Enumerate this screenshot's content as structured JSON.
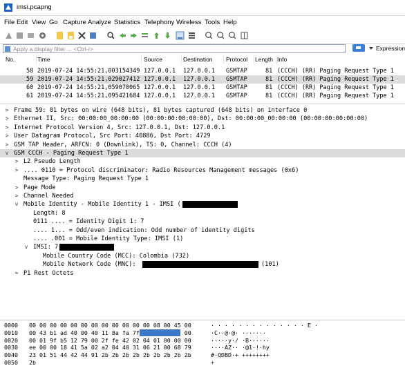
{
  "window": {
    "title": "imsi.pcapng"
  },
  "menu": [
    "File",
    "Edit",
    "View",
    "Go",
    "Capture",
    "Analyze",
    "Statistics",
    "Telephony",
    "Wireless",
    "Tools",
    "Help"
  ],
  "toolbar_icons": [
    "shark-fin-icon",
    "stop-icon",
    "restart-icon",
    "options-gear-icon",
    "open-file-icon",
    "save-file-icon",
    "close-file-icon",
    "reload-icon",
    "find-icon",
    "go-back-icon",
    "go-forward-icon",
    "go-to-packet-icon",
    "first-packet-icon",
    "last-packet-icon",
    "autoscroll-icon",
    "colorize-icon",
    "zoom-in-icon",
    "zoom-out-icon",
    "normal-size-icon",
    "resize-columns-icon"
  ],
  "filter": {
    "placeholder": "Apply a display filter ... <Ctrl-/>",
    "expression_label": "Expression"
  },
  "packet_list": {
    "columns": [
      "No.",
      "Time",
      "Source",
      "Destination",
      "Protocol",
      "Length",
      "Info"
    ],
    "rows": [
      {
        "no": "58",
        "time": "2019-07-24 14:55:21,003154349",
        "src": "127.0.0.1",
        "dst": "127.0.0.1",
        "proto": "GSMTAP",
        "len": "81",
        "info": "(CCCH) (RR) Paging Request Type 1",
        "selected": false
      },
      {
        "no": "59",
        "time": "2019-07-24 14:55:21,029027412",
        "src": "127.0.0.1",
        "dst": "127.0.0.1",
        "proto": "GSMTAP",
        "len": "81",
        "info": "(CCCH) (RR) Paging Request Type 1",
        "selected": true
      },
      {
        "no": "60",
        "time": "2019-07-24 14:55:21,059070065",
        "src": "127.0.0.1",
        "dst": "127.0.0.1",
        "proto": "GSMTAP",
        "len": "81",
        "info": "(CCCH) (RR) Paging Request Type 1",
        "selected": false
      },
      {
        "no": "61",
        "time": "2019-07-24 14:55:21,095421684",
        "src": "127.0.0.1",
        "dst": "127.0.0.1",
        "proto": "GSMTAP",
        "len": "81",
        "info": "(CCCH) (RR) Paging Request Type 1",
        "selected": false
      }
    ]
  },
  "details": [
    {
      "indent": 0,
      "toggle": ">",
      "text": "Frame 59: 81 bytes on wire (648 bits), 81 bytes captured (648 bits) on interface 0"
    },
    {
      "indent": 0,
      "toggle": ">",
      "text": "Ethernet II, Src: 00:00:00_00:00:00 (00:00:00:00:00:00), Dst: 00:00:00_00:00:00 (00:00:00:00:00:00)"
    },
    {
      "indent": 0,
      "toggle": ">",
      "text": "Internet Protocol Version 4, Src: 127.0.0.1, Dst: 127.0.0.1"
    },
    {
      "indent": 0,
      "toggle": ">",
      "text": "User Datagram Protocol, Src Port: 40886, Dst Port: 4729"
    },
    {
      "indent": 0,
      "toggle": ">",
      "text": "GSM TAP Header, ARFCN: 0 (Downlink), TS: 0, Channel: CCCH (4)"
    },
    {
      "indent": 0,
      "toggle": "v",
      "text": "GSM CCCH - Paging Request Type 1",
      "selected": true
    },
    {
      "indent": 1,
      "toggle": ">",
      "text": "L2 Pseudo Length"
    },
    {
      "indent": 1,
      "toggle": ">",
      "text": ".... 0110 = Protocol discriminator: Radio Resources Management messages (0x6)"
    },
    {
      "indent": 1,
      "toggle": "",
      "text": "Message Type: Paging Request Type 1"
    },
    {
      "indent": 1,
      "toggle": ">",
      "text": "Page Mode"
    },
    {
      "indent": 1,
      "toggle": ">",
      "text": "Channel Needed"
    },
    {
      "indent": 1,
      "toggle": "v",
      "text": "Mobile Identity - Mobile Identity 1 - IMSI (",
      "redact": [
        264,
        344
      ]
    },
    {
      "indent": 2,
      "toggle": "",
      "text": "Length: 8"
    },
    {
      "indent": 2,
      "toggle": "",
      "text": "0111 .... = Identity Digit 1: 7"
    },
    {
      "indent": 2,
      "toggle": "",
      "text": ".... 1... = Odd/even indication: Odd number of identity digits"
    },
    {
      "indent": 2,
      "toggle": "",
      "text": ".... .001 = Mobile Identity Type: IMSI (1)"
    },
    {
      "indent": 2,
      "toggle": "v",
      "text": "IMSI: 7",
      "redact": [
        86,
        165
      ]
    },
    {
      "indent": 3,
      "toggle": "",
      "text": "Mobile Country Code (MCC): Colombia (732)"
    },
    {
      "indent": 3,
      "toggle": "",
      "text": "Mobile Network Code (MNC):",
      "redact": [
        206,
        374
      ],
      "suffix": "(101)"
    },
    {
      "indent": 1,
      "toggle": ">",
      "text": "P1 Rest Octets"
    }
  ],
  "hex": [
    {
      "off": "0000",
      "bytes": "00 00 00 00 00 00 00 00  00 00 00 00 08 00 45 00",
      "ascii": "· · · · · · · ·  · · · · · · E ·"
    },
    {
      "off": "0010",
      "bytes": "00 43 b1 ad 40 00 40 11  8a fa 7f 00 00 01 7f 00",
      "ascii": "·C··@·@·  ·······",
      "hl": true
    },
    {
      "off": "0020",
      "bytes": "00 01 9f b5 12 79 00 2f  fe 42 02 04 01 00 00 00",
      "ascii": "·····y·/  ·B······"
    },
    {
      "off": "0030",
      "bytes": "ee 00 00 18 41 5a 02 a2  04 40 31 06 21 00 68 79",
      "ascii": "····AZ··  ·@1·!·hy"
    },
    {
      "off": "0040",
      "bytes": "23 01 51 44 42 44 91 2b  2b 2b 2b 2b 2b 2b 2b 2b",
      "ascii": "#·QDBD·+  ++++++++"
    },
    {
      "off": "0050",
      "bytes": "2b",
      "ascii": "+"
    }
  ]
}
